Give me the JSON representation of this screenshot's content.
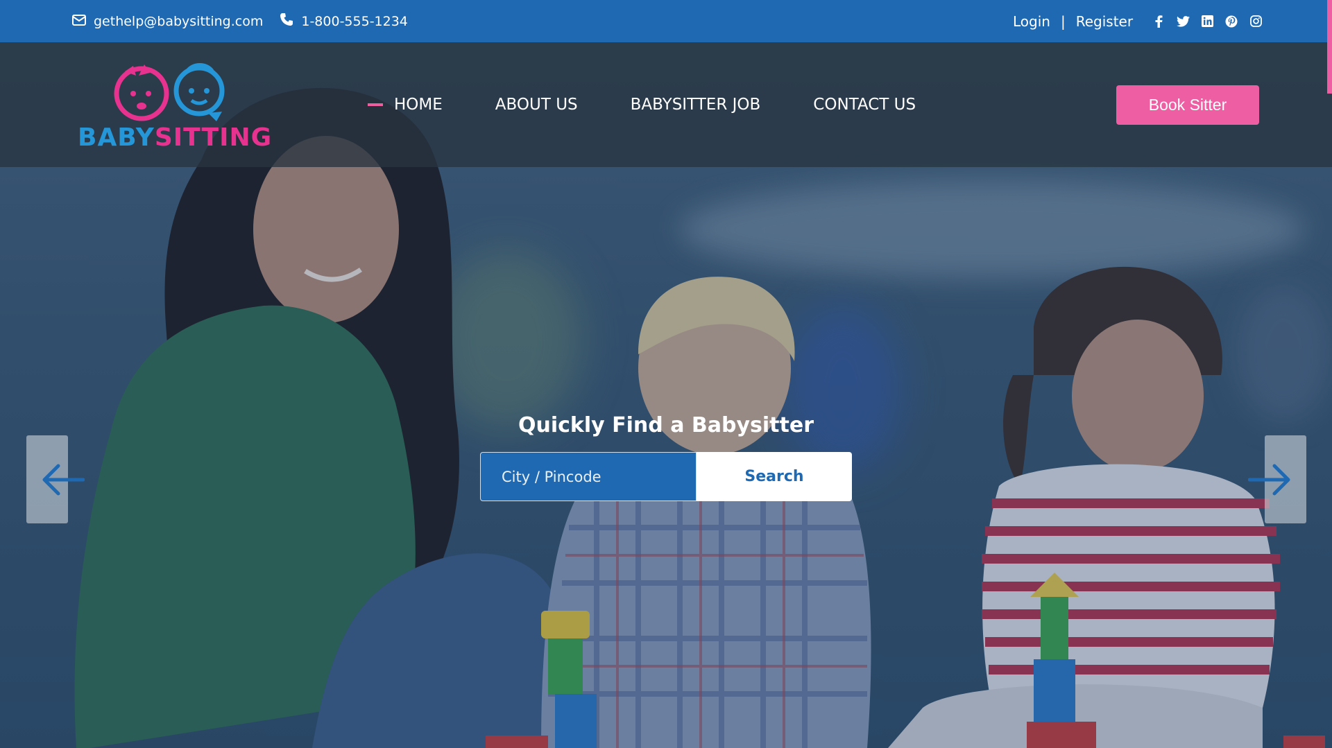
{
  "topbar": {
    "email": "gethelp@babysitting.com",
    "phone": "1-800-555-1234",
    "login_label": "Login",
    "separator": "|",
    "register_label": "Register",
    "social": [
      {
        "name": "facebook-icon",
        "glyph": "f"
      },
      {
        "name": "twitter-icon",
        "glyph": "t"
      },
      {
        "name": "linkedin-icon",
        "glyph": "in"
      },
      {
        "name": "pinterest-icon",
        "glyph": "p"
      },
      {
        "name": "instagram-icon",
        "glyph": "ig"
      }
    ]
  },
  "brand": {
    "name_part1": "BABY",
    "name_part2": "SITTING"
  },
  "nav": {
    "items": [
      {
        "label": "HOME",
        "active": true
      },
      {
        "label": "ABOUT US",
        "active": false
      },
      {
        "label": "BABYSITTER JOB",
        "active": false
      },
      {
        "label": "CONTACT US",
        "active": false
      }
    ],
    "cta_label": "Book Sitter"
  },
  "hero": {
    "search_title": "Quickly Find a Babysitter",
    "search_placeholder": "City / Pincode",
    "search_button": "Search"
  },
  "colors": {
    "brand_blue": "#1f69b3",
    "brand_pink": "#ee5ea3",
    "logo_blue": "#2596d8",
    "logo_pink": "#e8328f"
  }
}
